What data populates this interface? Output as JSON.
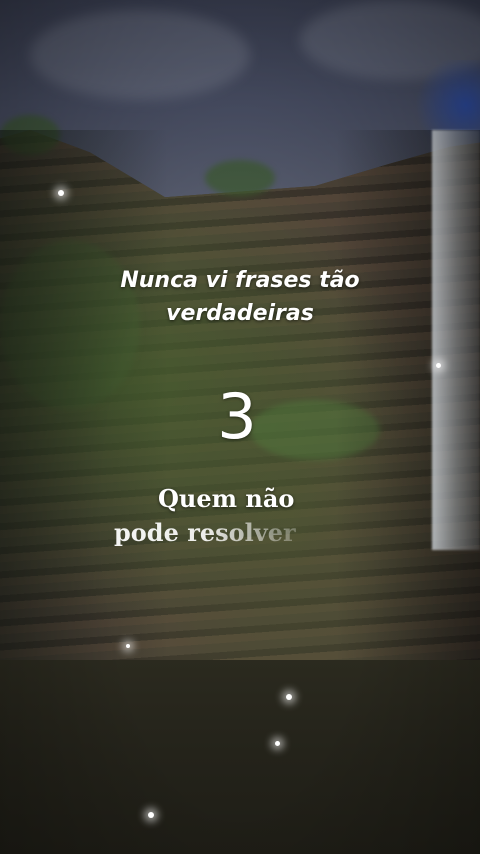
{
  "caption": {
    "line1": "Nunca vi frases tão",
    "line2": "verdadeiras"
  },
  "counter": "3",
  "quote": {
    "line1": "Quem não",
    "line2": "pode resolver"
  }
}
